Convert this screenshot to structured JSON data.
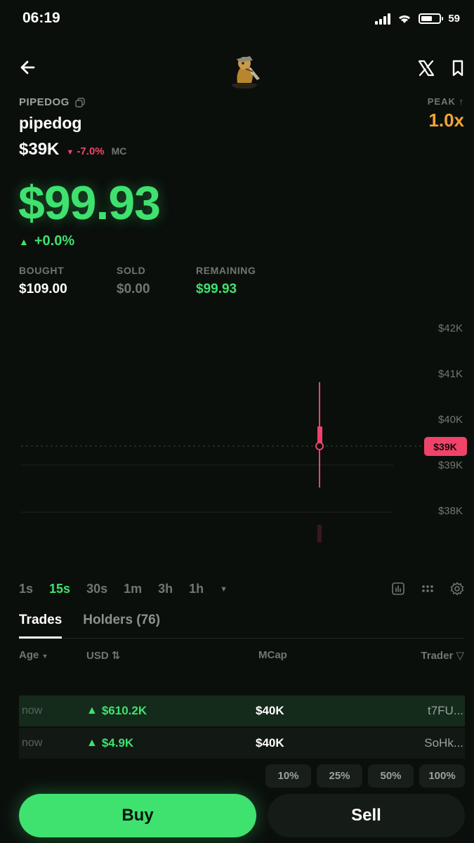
{
  "status_bar": {
    "time": "06:19",
    "battery": "59"
  },
  "token": {
    "ticker": "PIPEDOG",
    "name": "pipedog",
    "market_cap": "$39K",
    "mc_change": "-7.0%",
    "mc_label": "MC",
    "peak_label": "PEAK",
    "peak_value": "1.0x"
  },
  "position": {
    "value": "$99.93",
    "change": "+0.0%",
    "bought_label": "BOUGHT",
    "bought_value": "$109.00",
    "sold_label": "SOLD",
    "sold_value": "$0.00",
    "remaining_label": "REMAINING",
    "remaining_value": "$99.93"
  },
  "chart": {
    "y_ticks": [
      "$42K",
      "$41K",
      "$40K",
      "$39K",
      "$38K"
    ],
    "current_label": "$39K"
  },
  "timeframes": [
    "1s",
    "15s",
    "30s",
    "1m",
    "3h",
    "1h"
  ],
  "active_timeframe": "15s",
  "tabs": {
    "trades": "Trades",
    "holders": "Holders (76)"
  },
  "table": {
    "headers": {
      "age": "Age",
      "usd": "USD",
      "mcap": "MCap",
      "trader": "Trader"
    },
    "rows": [
      {
        "age": "now",
        "usd": "$610.2K",
        "mcap": "$40K",
        "trader": "t7FU..."
      },
      {
        "age": "now",
        "usd": "$4.9K",
        "mcap": "$40K",
        "trader": "SoHk..."
      }
    ]
  },
  "quick_amounts": [
    "10%",
    "25%",
    "50%",
    "100%"
  ],
  "actions": {
    "buy": "Buy",
    "sell": "Sell"
  },
  "colors": {
    "green": "#3fe16f",
    "red": "#f0436a",
    "peak": "#f0a531",
    "background": "#0b0f0c"
  },
  "icons": [
    "back-arrow-icon",
    "x-logo-icon",
    "bookmark-icon",
    "copy-icon",
    "chart-type-icon",
    "indicators-icon",
    "settings-icon",
    "sort-icon",
    "filter-icon"
  ]
}
